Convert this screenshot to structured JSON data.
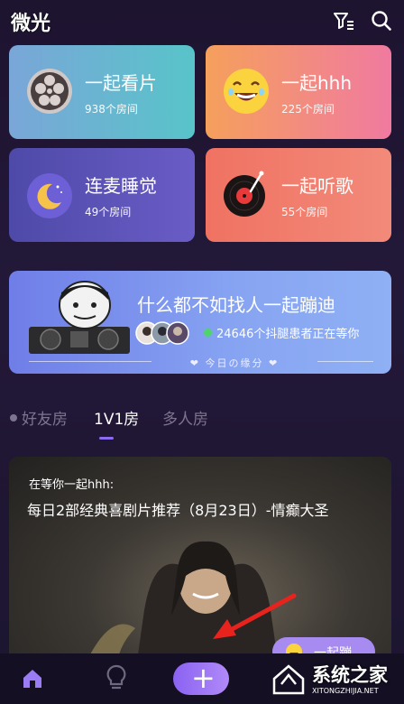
{
  "header": {
    "app_title": "微光"
  },
  "cards": [
    {
      "title": "一起看片",
      "rooms": "938个房间"
    },
    {
      "title": "一起hhh",
      "rooms": "225个房间"
    },
    {
      "title": "连麦睡觉",
      "rooms": "49个房间"
    },
    {
      "title": "一起听歌",
      "rooms": "55个房间"
    }
  ],
  "banner": {
    "title": "什么都不如找人一起蹦迪",
    "status": "24646个抖腿患者正在等你",
    "footer": "❤ 今日の缘分 ❤"
  },
  "tabs": [
    "好友房",
    "1V1房",
    "多人房"
  ],
  "active_tab": "1V1房",
  "feed": {
    "label": "在等你一起hhh:",
    "title": "每日2部经典喜剧片推荐（8月23日）-情癫大圣",
    "join_label": "一起蹦"
  },
  "watermark": {
    "text": "系统之家",
    "url": "XITONGZHIJIA.NET"
  },
  "colors": {
    "accent": "#8b6cf0",
    "background": "#1d1430",
    "online": "#4fd46a"
  },
  "icons": [
    "filter-icon",
    "search-icon",
    "film-reel-icon",
    "laughing-face-icon",
    "moon-icon",
    "vinyl-record-icon",
    "home-icon",
    "lightbulb-icon",
    "plus-icon",
    "red-arrow-annotation"
  ]
}
